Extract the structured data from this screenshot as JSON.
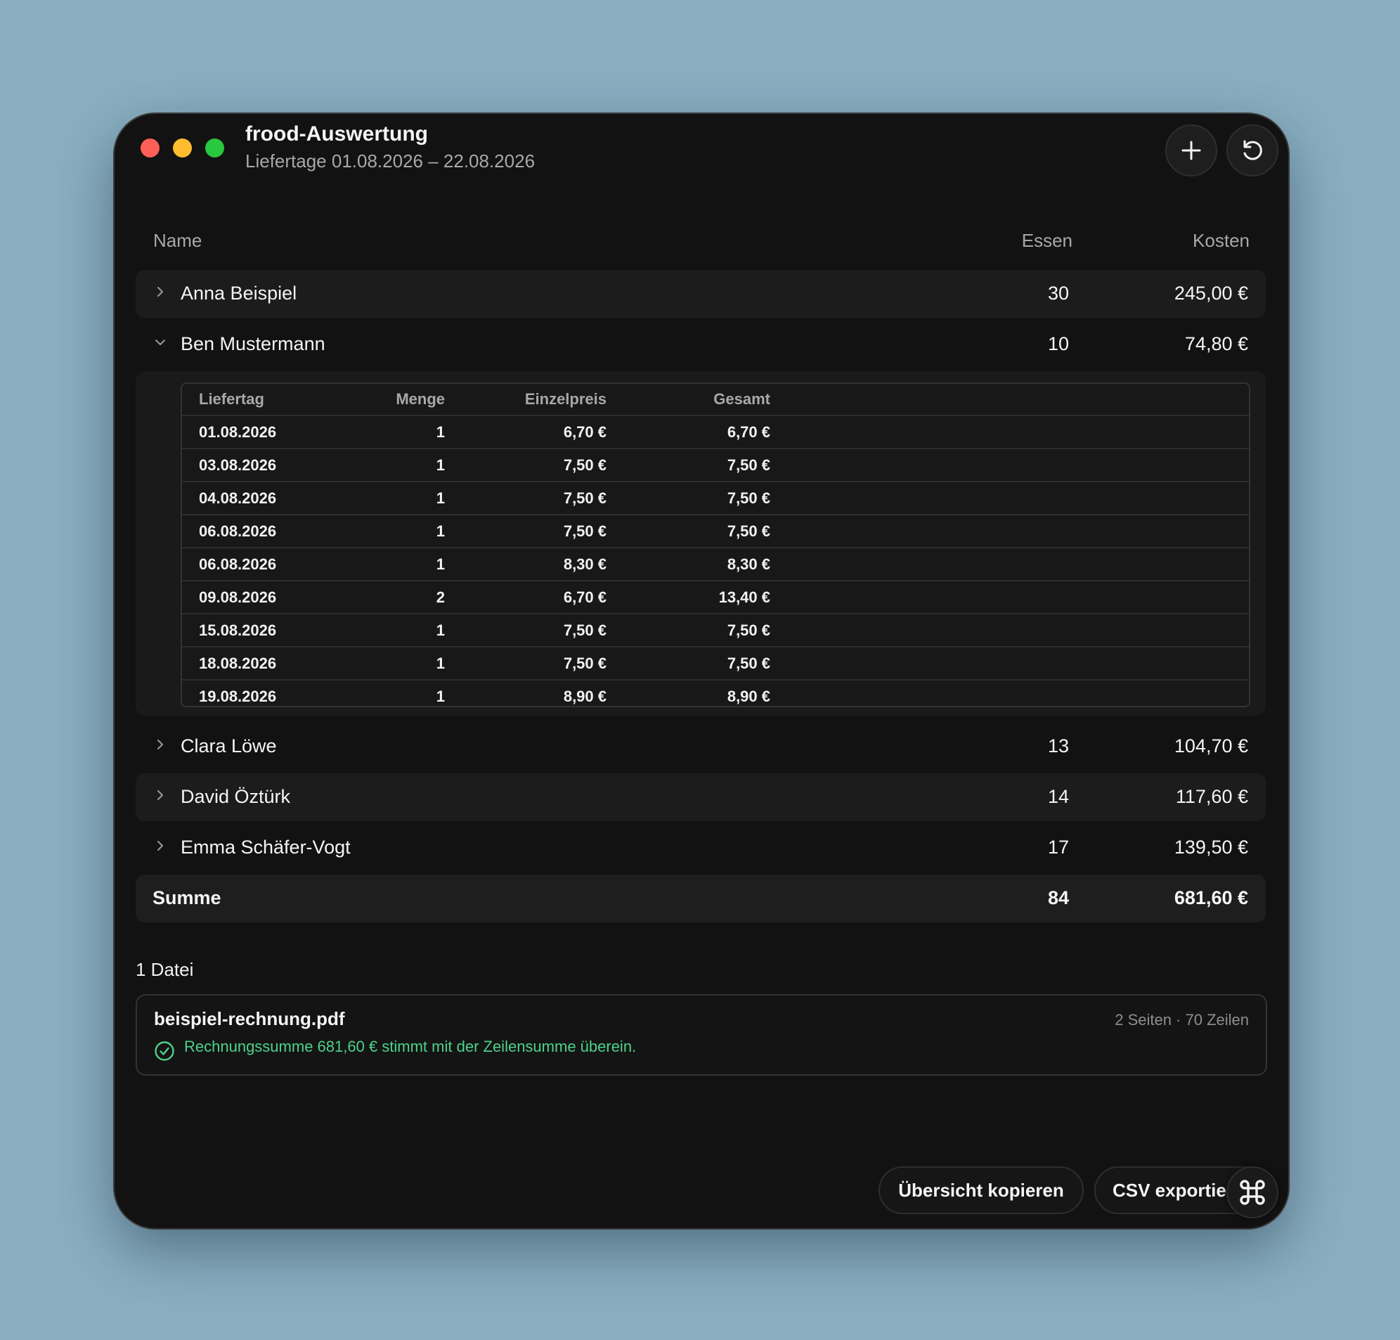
{
  "window": {
    "title": "frood-Auswertung",
    "subtitle": "Liefertage 01.08.2026 – 22.08.2026"
  },
  "toolbar": {
    "add_icon": "plus-icon",
    "reload_icon": "reload-icon"
  },
  "table": {
    "headers": {
      "name": "Name",
      "meals": "Essen",
      "cost": "Kosten"
    },
    "people": [
      {
        "name": "Anna Beispiel",
        "meals": "30",
        "cost": "245,00 €",
        "expanded": false
      },
      {
        "name": "Ben Mustermann",
        "meals": "10",
        "cost": "74,80 €",
        "expanded": true
      },
      {
        "name": "Clara Löwe",
        "meals": "13",
        "cost": "104,70 €",
        "expanded": false
      },
      {
        "name": "David Öztürk",
        "meals": "14",
        "cost": "117,60 €",
        "expanded": false
      },
      {
        "name": "Emma Schäfer-Vogt",
        "meals": "17",
        "cost": "139,50 €",
        "expanded": false
      }
    ],
    "detail": {
      "headers": [
        "Liefertag",
        "Menge",
        "Einzelpreis",
        "Gesamt"
      ],
      "rows": [
        [
          "01.08.2026",
          "1",
          "6,70 €",
          "6,70 €"
        ],
        [
          "03.08.2026",
          "1",
          "7,50 €",
          "7,50 €"
        ],
        [
          "04.08.2026",
          "1",
          "7,50 €",
          "7,50 €"
        ],
        [
          "06.08.2026",
          "1",
          "7,50 €",
          "7,50 €"
        ],
        [
          "06.08.2026",
          "1",
          "8,30 €",
          "8,30 €"
        ],
        [
          "09.08.2026",
          "2",
          "6,70 €",
          "13,40 €"
        ],
        [
          "15.08.2026",
          "1",
          "7,50 €",
          "7,50 €"
        ],
        [
          "18.08.2026",
          "1",
          "7,50 €",
          "7,50 €"
        ],
        [
          "19.08.2026",
          "1",
          "8,90 €",
          "8,90 €"
        ]
      ]
    },
    "total": {
      "label": "Summe",
      "meals": "84",
      "cost": "681,60 €"
    }
  },
  "files": {
    "label": "1 Datei",
    "items": [
      {
        "name": "beispiel-rechnung.pdf",
        "meta": "2 Seiten · 70 Zeilen",
        "status": "Rechnungssumme 681,60 € stimmt mit der Zeilensumme überein.",
        "status_color": "#4cd38a"
      }
    ]
  },
  "actions": {
    "copy_label": "Übersicht kopieren",
    "csv_label": "CSV exportieren",
    "cmd_icon": "command-icon"
  }
}
